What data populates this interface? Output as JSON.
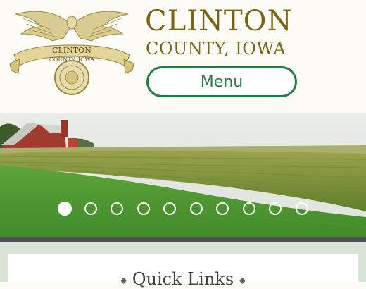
{
  "header": {
    "title": "CLINTON",
    "subtitle": "COUNTY, IOWA",
    "menu_label": "Menu",
    "seal_top": "CLINTON",
    "seal_bottom": "COUNTY, IOWA"
  },
  "slider": {
    "total_slides": 10,
    "active_index": 0
  },
  "quick_links": {
    "title": "Quick Links",
    "ornament_left": "◆",
    "ornament_right": "◆"
  },
  "colors": {
    "brand_gold": "#7a6217",
    "menu_green": "#1f7d46",
    "band_green": "#d9e4d7"
  },
  "icons": {
    "logo": "eagle-seal-icon"
  }
}
